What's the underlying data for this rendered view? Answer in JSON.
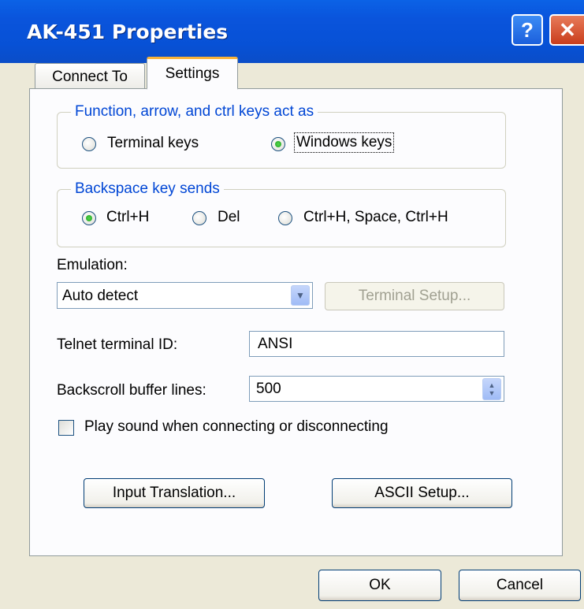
{
  "window": {
    "title": "AK-451 Properties",
    "help_label": "?",
    "close_label": "✕"
  },
  "tabs": [
    {
      "label": "Connect To"
    },
    {
      "label": "Settings"
    }
  ],
  "function_keys_group": {
    "legend": "Function, arrow, and ctrl keys act as",
    "options": [
      {
        "label": "Terminal keys",
        "selected": false
      },
      {
        "label": "Windows keys",
        "selected": true
      }
    ]
  },
  "backspace_group": {
    "legend": "Backspace key sends",
    "options": [
      {
        "label": "Ctrl+H",
        "selected": true
      },
      {
        "label": "Del",
        "selected": false
      },
      {
        "label": "Ctrl+H, Space, Ctrl+H",
        "selected": false
      }
    ]
  },
  "emulation": {
    "label": "Emulation:",
    "value": "Auto detect",
    "terminal_setup_label": "Terminal Setup..."
  },
  "telnet": {
    "label": "Telnet terminal ID:",
    "value": "ANSI"
  },
  "backscroll": {
    "label": "Backscroll buffer lines:",
    "value": "500"
  },
  "sound": {
    "label": "Play sound when connecting or disconnecting",
    "checked": false
  },
  "buttons": {
    "input_translation": "Input Translation...",
    "ascii_setup": "ASCII Setup...",
    "ok": "OK",
    "cancel": "Cancel"
  },
  "colors": {
    "title_blue": "#0a54dc",
    "legend_blue": "#0046d5",
    "dialog_bg": "#ece9d8"
  }
}
